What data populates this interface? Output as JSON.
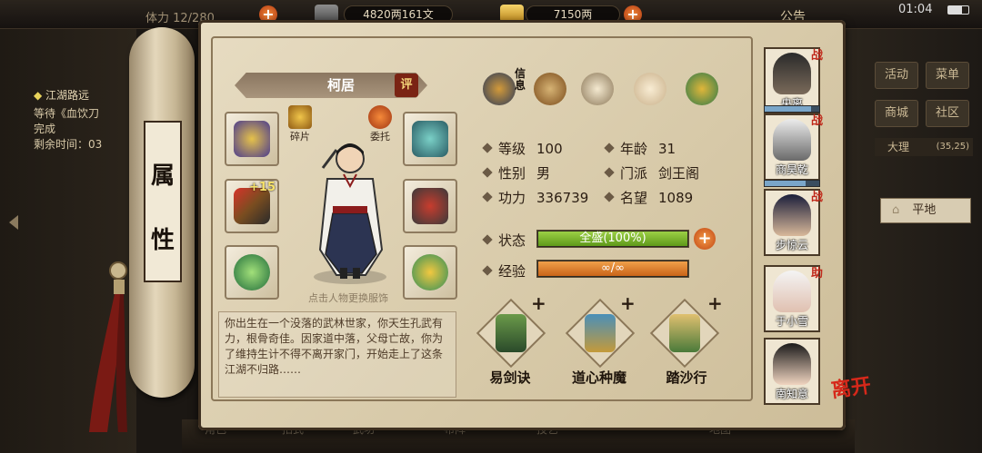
{
  "top_bar": {
    "partial_left": "体力 12/280",
    "money_copper": "4820两161文",
    "money_silver": "7150两",
    "announcement": "公告",
    "clock": "01:04"
  },
  "left_panel": {
    "quest_title": "江湖路远",
    "quest_line2": "等待《血饮刀",
    "quest_line3": "完成",
    "quest_line4": "剩余时间：03"
  },
  "right_panel": {
    "btn_activity": "活动",
    "btn_menu": "菜单",
    "btn_shop": "商城",
    "btn_community": "社区",
    "region": "大理",
    "coords": "(35,25)",
    "terrain": "平地"
  },
  "scroll_label": [
    "属",
    "性"
  ],
  "character": {
    "name": "柯居",
    "rate_label": "评",
    "fragment_label": "碎片",
    "entrust_label": "委托",
    "change_hint": "点击人物更换服饰",
    "enhance_level": "+15",
    "bio": "你出生在一个没落的武林世家，你天生孔武有力，根骨奇佳。因家道中落，父母亡故，你为了维持生计不得不离开家门，开始走上了这条江湖不归路……"
  },
  "tabs": {
    "info_label": "信息",
    "items": [
      "info-tab",
      "scroll-tab",
      "taiji-tab",
      "body-tab",
      "compass-tab"
    ]
  },
  "stats": {
    "level_label": "等级",
    "level": "100",
    "age_label": "年龄",
    "age": "31",
    "gender_label": "性别",
    "gender": "男",
    "sect_label": "门派",
    "sect": "剑王阁",
    "power_label": "功力",
    "power": "336739",
    "fame_label": "名望",
    "fame": "1089",
    "state_label": "状态",
    "state": "全盛(100%)",
    "state_fraction": 1.0,
    "exp_label": "经验",
    "exp": "∞/∞",
    "exp_fraction": 1.0
  },
  "skills": [
    {
      "name": "易剑诀"
    },
    {
      "name": "道心种魔"
    },
    {
      "name": "踏沙行"
    }
  ],
  "team": [
    {
      "name": "央离",
      "tag": "战",
      "bar": 0.85
    },
    {
      "name": "商昊乾",
      "tag": "战",
      "bar": 0.75
    },
    {
      "name": "步惊云",
      "tag": "战",
      "bar": 0.0
    },
    {
      "name": "于小雪",
      "tag": "助",
      "bar": 0.0
    },
    {
      "name": "南知意",
      "tag": "",
      "bar": 0.0
    }
  ],
  "leave_label": "离开",
  "bottom_bar": [
    "角色",
    "招式",
    "武功",
    "布阵",
    "技艺",
    "地图"
  ]
}
